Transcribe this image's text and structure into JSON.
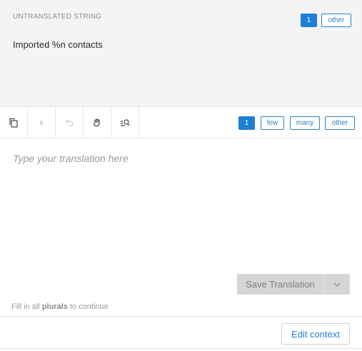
{
  "source": {
    "label": "UNTRANSLATED STRING",
    "text": "Imported %n contacts",
    "plural_tabs": [
      "1",
      "other"
    ]
  },
  "toolbar": {
    "tools": [
      {
        "icon": "copy-icon"
      },
      {
        "icon": "lightning-icon"
      },
      {
        "icon": "undo-icon"
      },
      {
        "icon": "hand-icon"
      },
      {
        "icon": "search-list-icon"
      }
    ],
    "plural_tabs": [
      "1",
      "few",
      "many",
      "other"
    ]
  },
  "editor": {
    "placeholder": "Type your translation here"
  },
  "save": {
    "label": "Save Translation"
  },
  "hint": {
    "prefix": "Fill in all",
    "bold": "plurals",
    "suffix": "to continue"
  },
  "footer": {
    "edit_context_label": "Edit context"
  },
  "colors": {
    "accent": "#1e7fd6",
    "source_bg": "#f4f4f4",
    "disabled_btn": "#d6d6d6"
  }
}
